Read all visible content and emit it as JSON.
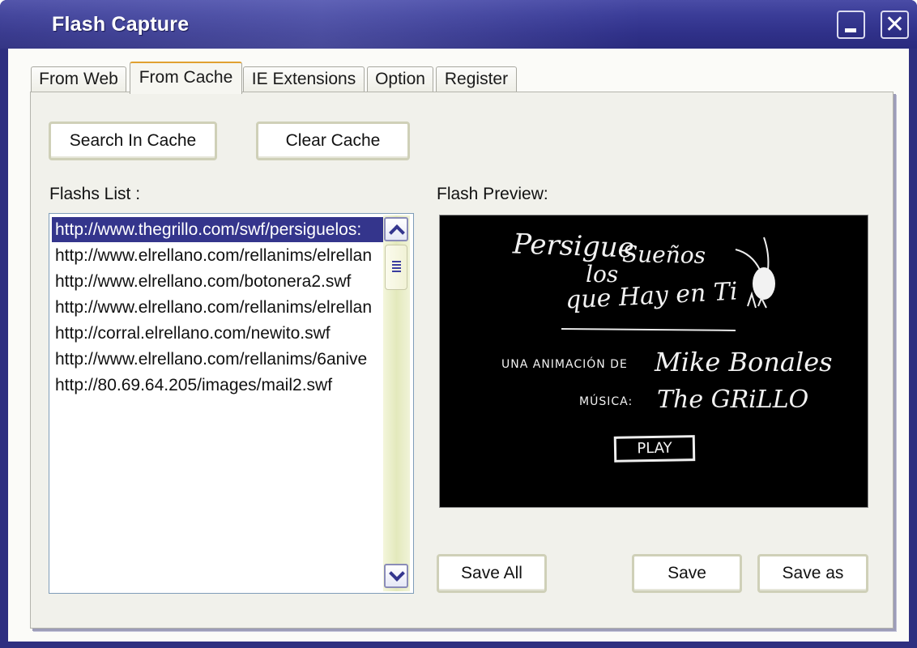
{
  "window": {
    "title": "Flash Capture",
    "minimize_icon": "minimize-icon",
    "close_icon": "close-icon",
    "close_glyph": "✕"
  },
  "tabs": [
    {
      "label": "From Web",
      "active": false
    },
    {
      "label": "From Cache",
      "active": true
    },
    {
      "label": "IE Extensions",
      "active": false
    },
    {
      "label": "Option",
      "active": false
    },
    {
      "label": "Register",
      "active": false
    }
  ],
  "toolbar": {
    "search_label": "Search In Cache",
    "clear_label": "Clear Cache"
  },
  "flash_list": {
    "label": "Flashs List :",
    "items": [
      {
        "url": "http://www.thegrillo.com/swf/persiguelos:",
        "selected": true
      },
      {
        "url": "http://www.elrellano.com/rellanims/elrellan",
        "selected": false
      },
      {
        "url": "http://www.elrellano.com/botonera2.swf",
        "selected": false
      },
      {
        "url": "http://www.elrellano.com/rellanims/elrellan",
        "selected": false
      },
      {
        "url": "http://corral.elrellano.com/newito.swf",
        "selected": false
      },
      {
        "url": "http://www.elrellano.com/rellanims/6anive",
        "selected": false
      },
      {
        "url": "http://80.69.64.205/images/mail2.swf",
        "selected": false
      }
    ]
  },
  "preview": {
    "label": "Flash Preview:",
    "content": {
      "line1a": "Persigue",
      "line1b": "Sueños",
      "line2": "los",
      "line3": "que Hay en Ti",
      "credit_prefix": "UNA ANIMACIÓN DE",
      "credit_name": "Mike Bonales",
      "music_prefix": "MÚSICA:",
      "music_name": "The GRiLLO",
      "play_label": "PLAY"
    }
  },
  "actions": {
    "save_all_label": "Save All",
    "save_label": "Save",
    "save_as_label": "Save as"
  },
  "colors": {
    "titlebar": "#2e2f80",
    "selection": "#34358c",
    "panel": "#f1f1eb"
  }
}
